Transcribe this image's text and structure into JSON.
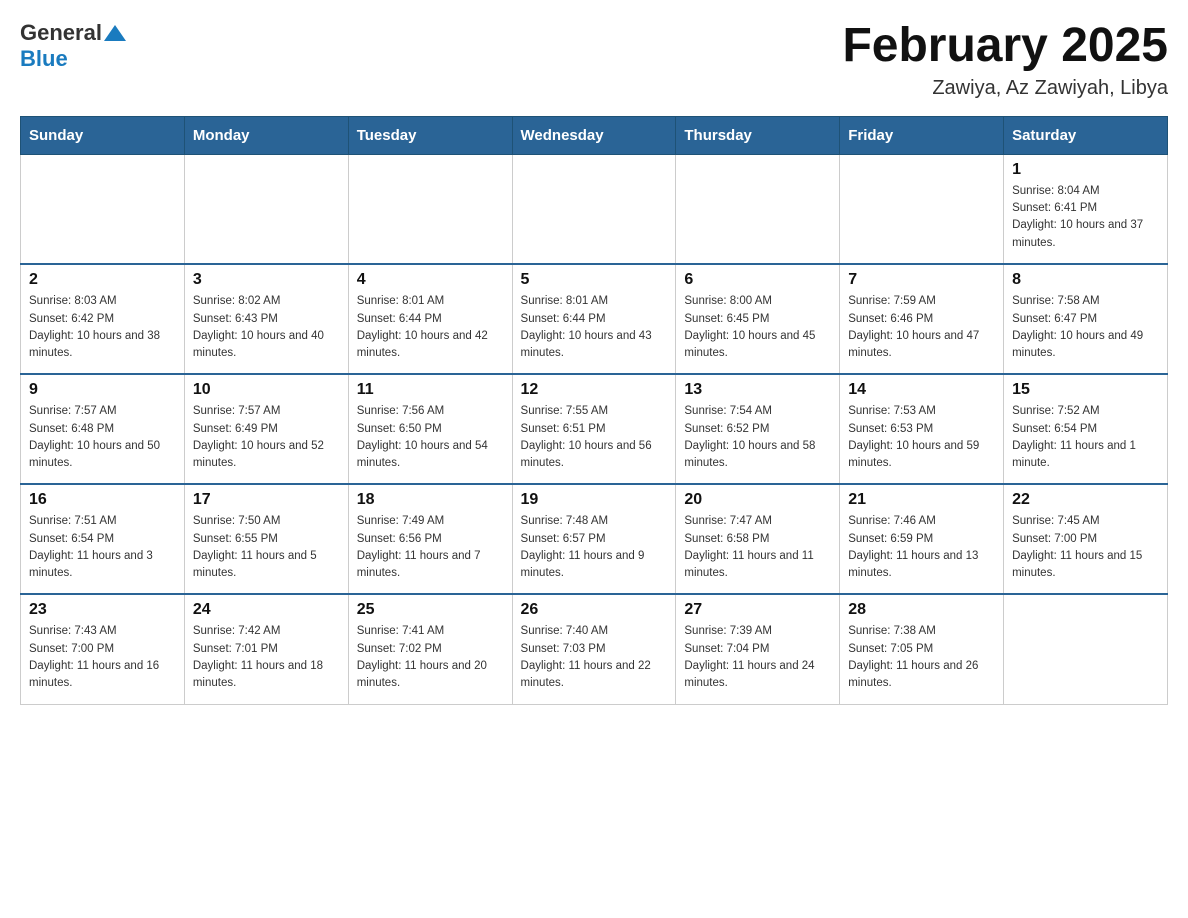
{
  "header": {
    "logo_general": "General",
    "logo_blue": "Blue",
    "month_title": "February 2025",
    "location": "Zawiya, Az Zawiyah, Libya"
  },
  "weekdays": [
    "Sunday",
    "Monday",
    "Tuesday",
    "Wednesday",
    "Thursday",
    "Friday",
    "Saturday"
  ],
  "weeks": [
    [
      {
        "day": "",
        "sunrise": "",
        "sunset": "",
        "daylight": ""
      },
      {
        "day": "",
        "sunrise": "",
        "sunset": "",
        "daylight": ""
      },
      {
        "day": "",
        "sunrise": "",
        "sunset": "",
        "daylight": ""
      },
      {
        "day": "",
        "sunrise": "",
        "sunset": "",
        "daylight": ""
      },
      {
        "day": "",
        "sunrise": "",
        "sunset": "",
        "daylight": ""
      },
      {
        "day": "",
        "sunrise": "",
        "sunset": "",
        "daylight": ""
      },
      {
        "day": "1",
        "sunrise": "Sunrise: 8:04 AM",
        "sunset": "Sunset: 6:41 PM",
        "daylight": "Daylight: 10 hours and 37 minutes."
      }
    ],
    [
      {
        "day": "2",
        "sunrise": "Sunrise: 8:03 AM",
        "sunset": "Sunset: 6:42 PM",
        "daylight": "Daylight: 10 hours and 38 minutes."
      },
      {
        "day": "3",
        "sunrise": "Sunrise: 8:02 AM",
        "sunset": "Sunset: 6:43 PM",
        "daylight": "Daylight: 10 hours and 40 minutes."
      },
      {
        "day": "4",
        "sunrise": "Sunrise: 8:01 AM",
        "sunset": "Sunset: 6:44 PM",
        "daylight": "Daylight: 10 hours and 42 minutes."
      },
      {
        "day": "5",
        "sunrise": "Sunrise: 8:01 AM",
        "sunset": "Sunset: 6:44 PM",
        "daylight": "Daylight: 10 hours and 43 minutes."
      },
      {
        "day": "6",
        "sunrise": "Sunrise: 8:00 AM",
        "sunset": "Sunset: 6:45 PM",
        "daylight": "Daylight: 10 hours and 45 minutes."
      },
      {
        "day": "7",
        "sunrise": "Sunrise: 7:59 AM",
        "sunset": "Sunset: 6:46 PM",
        "daylight": "Daylight: 10 hours and 47 minutes."
      },
      {
        "day": "8",
        "sunrise": "Sunrise: 7:58 AM",
        "sunset": "Sunset: 6:47 PM",
        "daylight": "Daylight: 10 hours and 49 minutes."
      }
    ],
    [
      {
        "day": "9",
        "sunrise": "Sunrise: 7:57 AM",
        "sunset": "Sunset: 6:48 PM",
        "daylight": "Daylight: 10 hours and 50 minutes."
      },
      {
        "day": "10",
        "sunrise": "Sunrise: 7:57 AM",
        "sunset": "Sunset: 6:49 PM",
        "daylight": "Daylight: 10 hours and 52 minutes."
      },
      {
        "day": "11",
        "sunrise": "Sunrise: 7:56 AM",
        "sunset": "Sunset: 6:50 PM",
        "daylight": "Daylight: 10 hours and 54 minutes."
      },
      {
        "day": "12",
        "sunrise": "Sunrise: 7:55 AM",
        "sunset": "Sunset: 6:51 PM",
        "daylight": "Daylight: 10 hours and 56 minutes."
      },
      {
        "day": "13",
        "sunrise": "Sunrise: 7:54 AM",
        "sunset": "Sunset: 6:52 PM",
        "daylight": "Daylight: 10 hours and 58 minutes."
      },
      {
        "day": "14",
        "sunrise": "Sunrise: 7:53 AM",
        "sunset": "Sunset: 6:53 PM",
        "daylight": "Daylight: 10 hours and 59 minutes."
      },
      {
        "day": "15",
        "sunrise": "Sunrise: 7:52 AM",
        "sunset": "Sunset: 6:54 PM",
        "daylight": "Daylight: 11 hours and 1 minute."
      }
    ],
    [
      {
        "day": "16",
        "sunrise": "Sunrise: 7:51 AM",
        "sunset": "Sunset: 6:54 PM",
        "daylight": "Daylight: 11 hours and 3 minutes."
      },
      {
        "day": "17",
        "sunrise": "Sunrise: 7:50 AM",
        "sunset": "Sunset: 6:55 PM",
        "daylight": "Daylight: 11 hours and 5 minutes."
      },
      {
        "day": "18",
        "sunrise": "Sunrise: 7:49 AM",
        "sunset": "Sunset: 6:56 PM",
        "daylight": "Daylight: 11 hours and 7 minutes."
      },
      {
        "day": "19",
        "sunrise": "Sunrise: 7:48 AM",
        "sunset": "Sunset: 6:57 PM",
        "daylight": "Daylight: 11 hours and 9 minutes."
      },
      {
        "day": "20",
        "sunrise": "Sunrise: 7:47 AM",
        "sunset": "Sunset: 6:58 PM",
        "daylight": "Daylight: 11 hours and 11 minutes."
      },
      {
        "day": "21",
        "sunrise": "Sunrise: 7:46 AM",
        "sunset": "Sunset: 6:59 PM",
        "daylight": "Daylight: 11 hours and 13 minutes."
      },
      {
        "day": "22",
        "sunrise": "Sunrise: 7:45 AM",
        "sunset": "Sunset: 7:00 PM",
        "daylight": "Daylight: 11 hours and 15 minutes."
      }
    ],
    [
      {
        "day": "23",
        "sunrise": "Sunrise: 7:43 AM",
        "sunset": "Sunset: 7:00 PM",
        "daylight": "Daylight: 11 hours and 16 minutes."
      },
      {
        "day": "24",
        "sunrise": "Sunrise: 7:42 AM",
        "sunset": "Sunset: 7:01 PM",
        "daylight": "Daylight: 11 hours and 18 minutes."
      },
      {
        "day": "25",
        "sunrise": "Sunrise: 7:41 AM",
        "sunset": "Sunset: 7:02 PM",
        "daylight": "Daylight: 11 hours and 20 minutes."
      },
      {
        "day": "26",
        "sunrise": "Sunrise: 7:40 AM",
        "sunset": "Sunset: 7:03 PM",
        "daylight": "Daylight: 11 hours and 22 minutes."
      },
      {
        "day": "27",
        "sunrise": "Sunrise: 7:39 AM",
        "sunset": "Sunset: 7:04 PM",
        "daylight": "Daylight: 11 hours and 24 minutes."
      },
      {
        "day": "28",
        "sunrise": "Sunrise: 7:38 AM",
        "sunset": "Sunset: 7:05 PM",
        "daylight": "Daylight: 11 hours and 26 minutes."
      },
      {
        "day": "",
        "sunrise": "",
        "sunset": "",
        "daylight": ""
      }
    ]
  ]
}
